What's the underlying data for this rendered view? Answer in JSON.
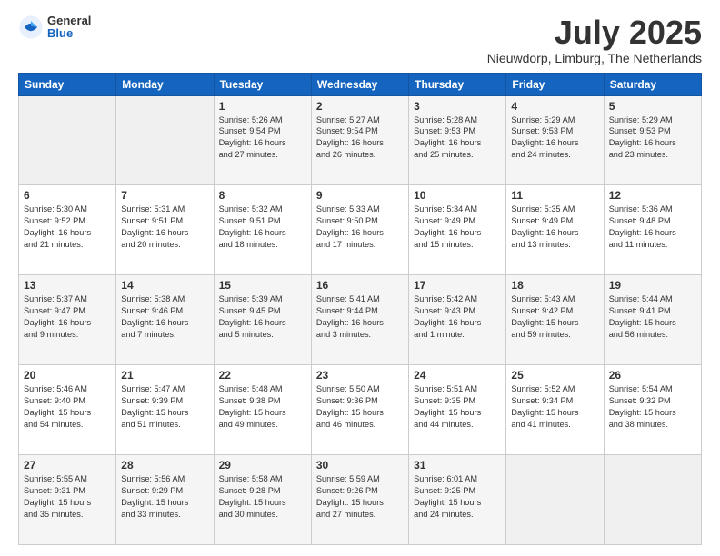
{
  "header": {
    "logo_general": "General",
    "logo_blue": "Blue",
    "month_title": "July 2025",
    "location": "Nieuwdorp, Limburg, The Netherlands"
  },
  "weekdays": [
    "Sunday",
    "Monday",
    "Tuesday",
    "Wednesday",
    "Thursday",
    "Friday",
    "Saturday"
  ],
  "weeks": [
    [
      {
        "day": "",
        "info": ""
      },
      {
        "day": "",
        "info": ""
      },
      {
        "day": "1",
        "info": "Sunrise: 5:26 AM\nSunset: 9:54 PM\nDaylight: 16 hours\nand 27 minutes."
      },
      {
        "day": "2",
        "info": "Sunrise: 5:27 AM\nSunset: 9:54 PM\nDaylight: 16 hours\nand 26 minutes."
      },
      {
        "day": "3",
        "info": "Sunrise: 5:28 AM\nSunset: 9:53 PM\nDaylight: 16 hours\nand 25 minutes."
      },
      {
        "day": "4",
        "info": "Sunrise: 5:29 AM\nSunset: 9:53 PM\nDaylight: 16 hours\nand 24 minutes."
      },
      {
        "day": "5",
        "info": "Sunrise: 5:29 AM\nSunset: 9:53 PM\nDaylight: 16 hours\nand 23 minutes."
      }
    ],
    [
      {
        "day": "6",
        "info": "Sunrise: 5:30 AM\nSunset: 9:52 PM\nDaylight: 16 hours\nand 21 minutes."
      },
      {
        "day": "7",
        "info": "Sunrise: 5:31 AM\nSunset: 9:51 PM\nDaylight: 16 hours\nand 20 minutes."
      },
      {
        "day": "8",
        "info": "Sunrise: 5:32 AM\nSunset: 9:51 PM\nDaylight: 16 hours\nand 18 minutes."
      },
      {
        "day": "9",
        "info": "Sunrise: 5:33 AM\nSunset: 9:50 PM\nDaylight: 16 hours\nand 17 minutes."
      },
      {
        "day": "10",
        "info": "Sunrise: 5:34 AM\nSunset: 9:49 PM\nDaylight: 16 hours\nand 15 minutes."
      },
      {
        "day": "11",
        "info": "Sunrise: 5:35 AM\nSunset: 9:49 PM\nDaylight: 16 hours\nand 13 minutes."
      },
      {
        "day": "12",
        "info": "Sunrise: 5:36 AM\nSunset: 9:48 PM\nDaylight: 16 hours\nand 11 minutes."
      }
    ],
    [
      {
        "day": "13",
        "info": "Sunrise: 5:37 AM\nSunset: 9:47 PM\nDaylight: 16 hours\nand 9 minutes."
      },
      {
        "day": "14",
        "info": "Sunrise: 5:38 AM\nSunset: 9:46 PM\nDaylight: 16 hours\nand 7 minutes."
      },
      {
        "day": "15",
        "info": "Sunrise: 5:39 AM\nSunset: 9:45 PM\nDaylight: 16 hours\nand 5 minutes."
      },
      {
        "day": "16",
        "info": "Sunrise: 5:41 AM\nSunset: 9:44 PM\nDaylight: 16 hours\nand 3 minutes."
      },
      {
        "day": "17",
        "info": "Sunrise: 5:42 AM\nSunset: 9:43 PM\nDaylight: 16 hours\nand 1 minute."
      },
      {
        "day": "18",
        "info": "Sunrise: 5:43 AM\nSunset: 9:42 PM\nDaylight: 15 hours\nand 59 minutes."
      },
      {
        "day": "19",
        "info": "Sunrise: 5:44 AM\nSunset: 9:41 PM\nDaylight: 15 hours\nand 56 minutes."
      }
    ],
    [
      {
        "day": "20",
        "info": "Sunrise: 5:46 AM\nSunset: 9:40 PM\nDaylight: 15 hours\nand 54 minutes."
      },
      {
        "day": "21",
        "info": "Sunrise: 5:47 AM\nSunset: 9:39 PM\nDaylight: 15 hours\nand 51 minutes."
      },
      {
        "day": "22",
        "info": "Sunrise: 5:48 AM\nSunset: 9:38 PM\nDaylight: 15 hours\nand 49 minutes."
      },
      {
        "day": "23",
        "info": "Sunrise: 5:50 AM\nSunset: 9:36 PM\nDaylight: 15 hours\nand 46 minutes."
      },
      {
        "day": "24",
        "info": "Sunrise: 5:51 AM\nSunset: 9:35 PM\nDaylight: 15 hours\nand 44 minutes."
      },
      {
        "day": "25",
        "info": "Sunrise: 5:52 AM\nSunset: 9:34 PM\nDaylight: 15 hours\nand 41 minutes."
      },
      {
        "day": "26",
        "info": "Sunrise: 5:54 AM\nSunset: 9:32 PM\nDaylight: 15 hours\nand 38 minutes."
      }
    ],
    [
      {
        "day": "27",
        "info": "Sunrise: 5:55 AM\nSunset: 9:31 PM\nDaylight: 15 hours\nand 35 minutes."
      },
      {
        "day": "28",
        "info": "Sunrise: 5:56 AM\nSunset: 9:29 PM\nDaylight: 15 hours\nand 33 minutes."
      },
      {
        "day": "29",
        "info": "Sunrise: 5:58 AM\nSunset: 9:28 PM\nDaylight: 15 hours\nand 30 minutes."
      },
      {
        "day": "30",
        "info": "Sunrise: 5:59 AM\nSunset: 9:26 PM\nDaylight: 15 hours\nand 27 minutes."
      },
      {
        "day": "31",
        "info": "Sunrise: 6:01 AM\nSunset: 9:25 PM\nDaylight: 15 hours\nand 24 minutes."
      },
      {
        "day": "",
        "info": ""
      },
      {
        "day": "",
        "info": ""
      }
    ]
  ]
}
